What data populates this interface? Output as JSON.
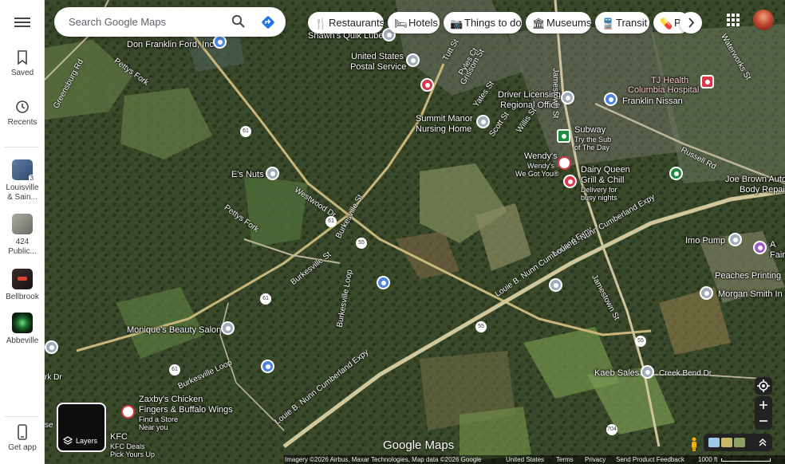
{
  "search": {
    "placeholder": "Search Google Maps"
  },
  "rail": {
    "saved": "Saved",
    "recents": "Recents",
    "recent_places": [
      {
        "label": "Louisville\n& Sain...",
        "line1": "Louisville",
        "line2": "& Sain...",
        "badge": "3"
      },
      {
        "line1": "424",
        "line2": "Public..."
      },
      {
        "line1": "Bellbrook",
        "line2": ""
      },
      {
        "line1": "Abbeville",
        "line2": ""
      }
    ],
    "get_app": "Get app"
  },
  "chips": [
    "Restaurants",
    "Hotels",
    "Things to do",
    "Museums",
    "Transit",
    "Ph"
  ],
  "map_labels": {
    "don_franklin": "Don Franklin Ford, Inc",
    "shawns": "Shawn's Quik Lube",
    "post_office_1": "United States",
    "post_office_2": "Postal Service",
    "summit_1": "Summit Manor",
    "summit_2": "Nursing Home",
    "driver_1": "Driver Licensing",
    "driver_2": "Regional Office",
    "tj_1": "TJ Health",
    "tj_2": "Columbia Hospital",
    "franklin_nissan": "Franklin Nissan",
    "subway": "Subway",
    "subway_sub1": "Try the Sub",
    "subway_sub2": "of The Day",
    "wendys": "Wendy's",
    "wendys_sub1": "Wendy's",
    "wendys_sub2": "We Got You®",
    "dq_1": "Dairy Queen",
    "dq_2": "Grill & Chill",
    "dq_sub1": "Delivery for",
    "dq_sub2": "busy nights",
    "es_nuts": "E's Nuts",
    "joe_1": "Joe Brown Autom",
    "joe_2": "Body Repair",
    "imo": "Imo Pump",
    "fair_1": "A",
    "fair_2": "Fair",
    "peaches": "Peaches Printing",
    "morgan": "Morgan Smith In",
    "moniques": "Monique's Beauty Salon",
    "kaeb": "Kaeb Sales",
    "zaxbys_1": "Zaxby's Chicken",
    "zaxbys_2": "Fingers & Buffalo Wings",
    "zaxbys_sub": "Find a Store",
    "zaxbys_sub2": "Near you",
    "kfc": "KFC",
    "kfc_sub1": "KFC Deals",
    "kfc_sub2": "Pick Yours Up",
    "pettys_fork_1": "Pettys Fork",
    "pettys_fork_2": "Pettys Fork",
    "greensburg": "Greensburg Rd",
    "westwood": "Westwood Dr",
    "burkesville_st": "Burkesville St",
    "burkesville_st2": "Burkesville St",
    "burkesville_loop": "Burkesville Loop",
    "burkesville_loop2": "Burkesville Loop",
    "louie_1": "Louie B. Nunn Cumberland Expy",
    "louie_2": "Louie B. Nunn Cumberland Expy",
    "louie_3": "Louie B. Nunn Cumberland Expy",
    "jamestown_1": "Jamestown St",
    "jamestown_2": "Jamestown St",
    "russell": "Russell Rd",
    "creek_bend": "Creek Bend Dr",
    "scott": "Scott St",
    "willis": "Willis St",
    "yates": "Yates St",
    "grissom": "Grissom St",
    "tutt": "Tutt St",
    "pyles": "Pyles Ct",
    "waterworks": "Waterworks St",
    "rk_dr": "rk Dr",
    "se": "se"
  },
  "shields": {
    "r61a": "61",
    "r61b": "61",
    "r61c": "61",
    "r61d": "61",
    "r55a": "55",
    "r55b": "55",
    "r55c": "55",
    "r704": "704"
  },
  "layers": {
    "label": "Layers"
  },
  "logo": "Google Maps",
  "footer": {
    "imagery": "Imagery ©2026 Airbus, Maxar Technologies, Map data ©2026 Google",
    "country": "United States",
    "terms": "Terms",
    "privacy": "Privacy",
    "feedback": "Send Product Feedback",
    "scale": "1000 ft"
  },
  "colors": {
    "blue_pin": "#4b85e0",
    "red_pin": "#d93848",
    "green_pin": "#1e8e3e",
    "purple_pin": "#9b5cc8",
    "gray_pin": "#a0acb8"
  }
}
